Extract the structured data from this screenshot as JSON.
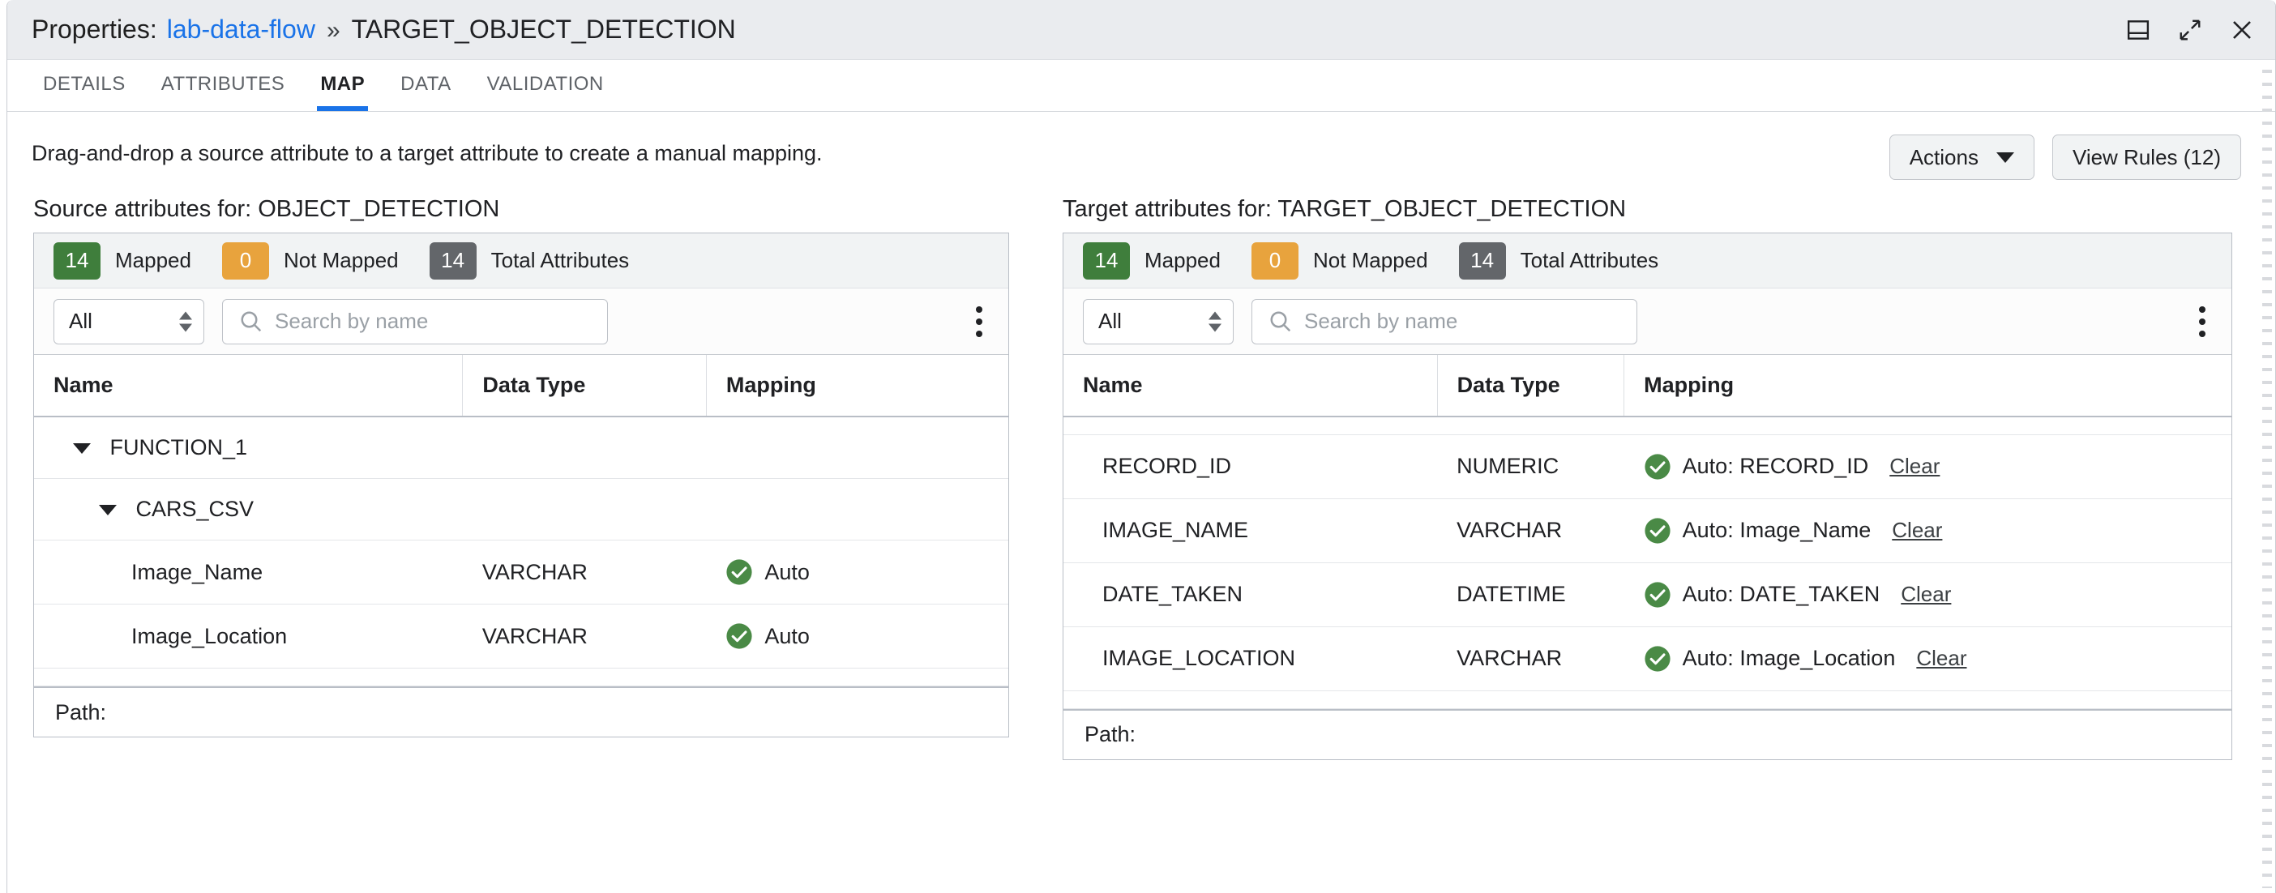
{
  "titlebar": {
    "prefix": "Properties:",
    "link": "lab-data-flow",
    "separator": "»",
    "target": "TARGET_OBJECT_DETECTION",
    "controls": [
      {
        "name": "dock-panel-icon",
        "label": "Dock"
      },
      {
        "name": "expand-icon",
        "label": "Expand"
      },
      {
        "name": "close-icon",
        "label": "Close"
      }
    ]
  },
  "tabs": [
    {
      "label": "DETAILS",
      "active": false
    },
    {
      "label": "ATTRIBUTES",
      "active": false
    },
    {
      "label": "MAP",
      "active": true
    },
    {
      "label": "DATA",
      "active": false
    },
    {
      "label": "VALIDATION",
      "active": false
    }
  ],
  "toolbar": {
    "instruction": "Drag-and-drop a source attribute to a target attribute to create a manual mapping.",
    "actions_label": "Actions",
    "view_rules_label": "View Rules (12)"
  },
  "colors": {
    "accent": "#1a73e8",
    "mapped_badge": "#3f7e3c",
    "not_mapped_badge": "#e8a33d",
    "total_badge": "#63666a",
    "check_green": "#4a8a46"
  },
  "source_panel": {
    "heading": "Source attributes for: OBJECT_DETECTION",
    "stats": {
      "mapped_count": "14",
      "mapped_label": "Mapped",
      "not_mapped_count": "0",
      "not_mapped_label": "Not Mapped",
      "total_count": "14",
      "total_label": "Total Attributes"
    },
    "filter": {
      "selected": "All",
      "search_placeholder": "Search by name",
      "search_value": ""
    },
    "columns": [
      "Name",
      "Data Type",
      "Mapping"
    ],
    "rows": [
      {
        "kind": "group",
        "indent": 1,
        "name": "FUNCTION_1",
        "data_type": "",
        "mapping": ""
      },
      {
        "kind": "group",
        "indent": 2,
        "name": "CARS_CSV",
        "data_type": "",
        "mapping": ""
      },
      {
        "kind": "attr",
        "indent": 3,
        "name": "Image_Name",
        "data_type": "VARCHAR",
        "mapping": "Auto",
        "mapped": true
      },
      {
        "kind": "attr",
        "indent": 3,
        "name": "Image_Location",
        "data_type": "VARCHAR",
        "mapping": "Auto",
        "mapped": true
      }
    ],
    "path_label": "Path:"
  },
  "target_panel": {
    "heading": "Target attributes for: TARGET_OBJECT_DETECTION",
    "stats": {
      "mapped_count": "14",
      "mapped_label": "Mapped",
      "not_mapped_count": "0",
      "not_mapped_label": "Not Mapped",
      "total_count": "14",
      "total_label": "Total Attributes"
    },
    "filter": {
      "selected": "All",
      "search_placeholder": "Search by name",
      "search_value": ""
    },
    "columns": [
      "Name",
      "Data Type",
      "Mapping"
    ],
    "rows": [
      {
        "kind": "attr",
        "name": "RECORD_ID",
        "data_type": "NUMERIC",
        "mapping": "Auto: RECORD_ID",
        "clear": "Clear",
        "mapped": true
      },
      {
        "kind": "attr",
        "name": "IMAGE_NAME",
        "data_type": "VARCHAR",
        "mapping": "Auto: Image_Name",
        "clear": "Clear",
        "mapped": true
      },
      {
        "kind": "attr",
        "name": "DATE_TAKEN",
        "data_type": "DATETIME",
        "mapping": "Auto: DATE_TAKEN",
        "clear": "Clear",
        "mapped": true
      },
      {
        "kind": "attr",
        "name": "IMAGE_LOCATION",
        "data_type": "VARCHAR",
        "mapping": "Auto: Image_Location",
        "clear": "Clear",
        "mapped": true
      }
    ],
    "path_label": "Path:"
  }
}
